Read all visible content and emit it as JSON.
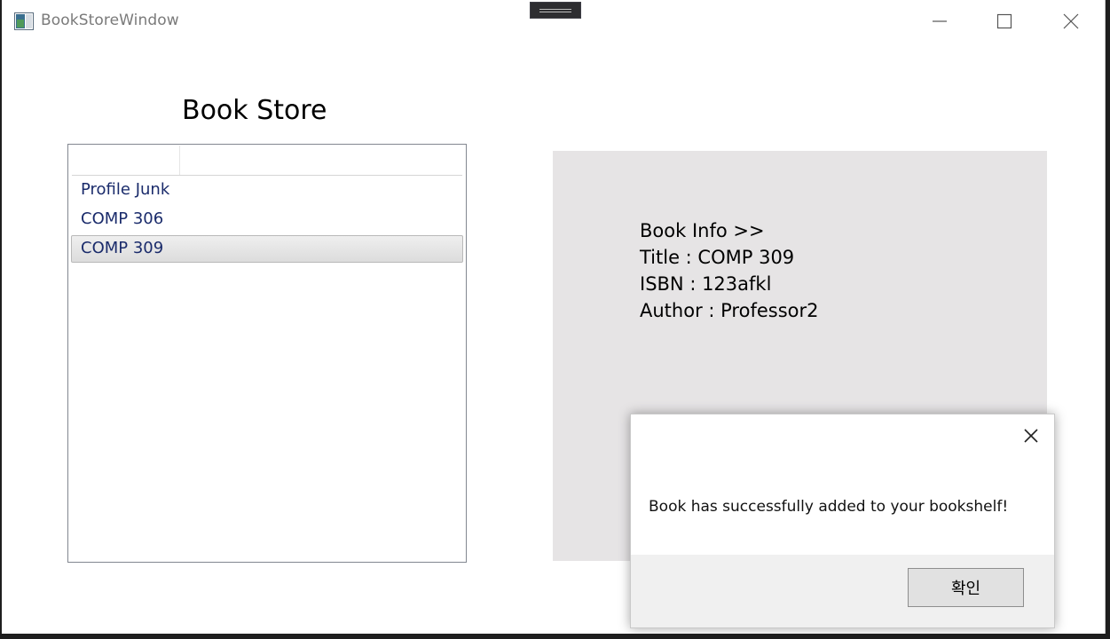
{
  "window": {
    "title": "BookStoreWindow"
  },
  "store": {
    "heading": "Book Store",
    "books": [
      {
        "label": "Profile Junk"
      },
      {
        "label": "COMP 306"
      },
      {
        "label": "COMP 309",
        "selected": true
      }
    ]
  },
  "info": {
    "header": "Book Info >>",
    "title_line": "Title : COMP 309",
    "isbn_line": "ISBN : 123afkl",
    "author_line": "Author : Professor2"
  },
  "dialog": {
    "message": "Book has successfully added to your bookshelf!",
    "ok_label": "확인"
  },
  "colors": {
    "panel_bg": "#e6e4e5",
    "list_text": "#1a2b6b"
  }
}
